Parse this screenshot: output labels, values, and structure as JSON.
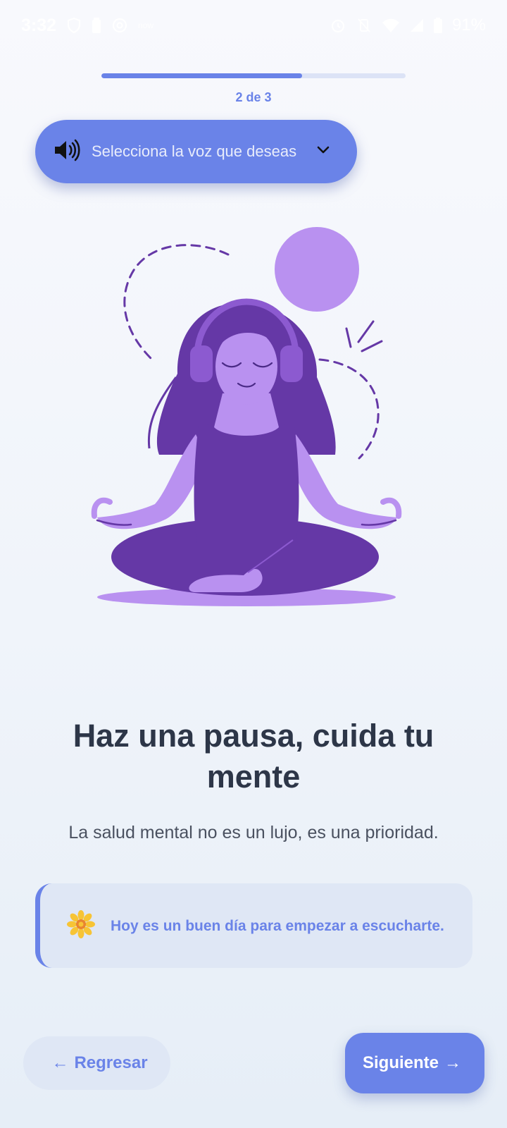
{
  "status_bar": {
    "time": "3:32",
    "battery": "91%",
    "notification_text": "now",
    "icons": [
      "shield-icon",
      "battery-saver-icon",
      "at-icon",
      "alarm-icon",
      "vibrate-icon",
      "wifi-icon",
      "signal-icon",
      "battery-icon"
    ]
  },
  "progress": {
    "label": "2 de 3",
    "current": 2,
    "total": 3,
    "fraction": 0.66
  },
  "voice_selector": {
    "label": "Selecciona la voz que deseas",
    "icon": "speaker-icon"
  },
  "illustration": {
    "subject": "meditating-woman-with-headphones"
  },
  "content": {
    "headline": "Haz una pausa, cuida tu mente",
    "subtitle": "La salud mental no es un lujo, es una prioridad."
  },
  "tip": {
    "icon": "flower-icon",
    "text": "Hoy es un buen día para empezar a escucharte."
  },
  "navigation": {
    "back_label": "Regresar",
    "back_arrow": "←",
    "next_label": "Siguiente",
    "next_arrow": "→"
  },
  "colors": {
    "accent": "#6a83e8",
    "illustration_dark": "#6538a6",
    "illustration_light": "#b991f0",
    "headline": "#2d3648",
    "card_bg": "#dfe7f5"
  }
}
